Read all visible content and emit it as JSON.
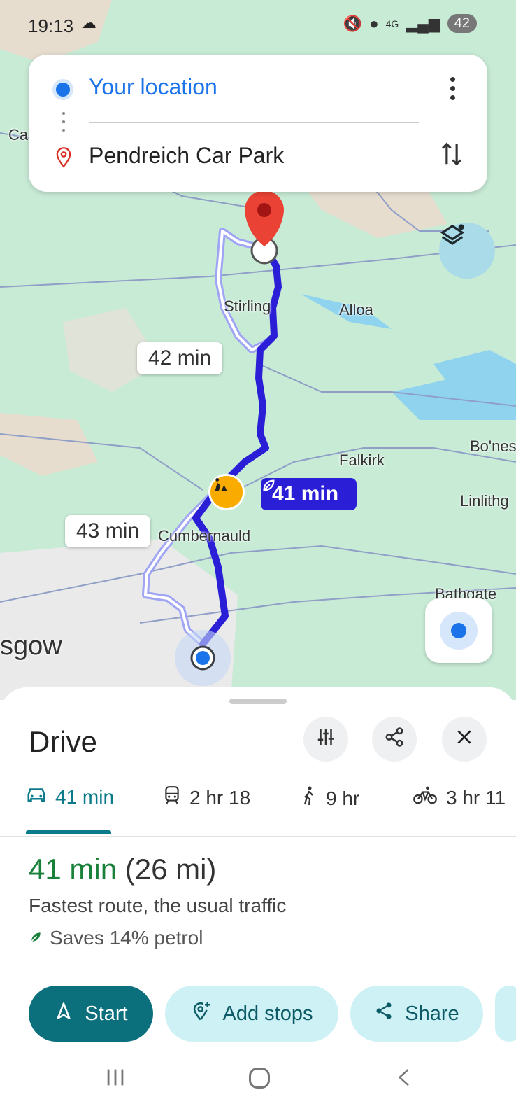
{
  "status_bar": {
    "time": "19:13",
    "battery": "42",
    "network": "4G"
  },
  "search": {
    "origin": "Your location",
    "destination": "Pendreich Car Park"
  },
  "map": {
    "labels": {
      "stirling": "Stirling",
      "alloa": "Alloa",
      "falkirk": "Falkirk",
      "bo_ness": "Bo'nes",
      "linlithgow": "Linlithg",
      "cumbernauld": "Cumbernauld",
      "bathgate": "Bathgate",
      "glasgow": "sgow",
      "ca": "Ca"
    },
    "route_bubbles": {
      "alt1": "42 min",
      "alt2": "43 min",
      "main": "41 min"
    },
    "route_color": "#2a1fd6",
    "alt_route_color": "#9fa4f5"
  },
  "sheet": {
    "title": "Drive",
    "modes": [
      {
        "label": "41 min",
        "icon": "car-icon"
      },
      {
        "label": "2 hr 18",
        "icon": "train-icon"
      },
      {
        "label": "9 hr",
        "icon": "walk-icon"
      },
      {
        "label": "3 hr 11",
        "icon": "bike-icon"
      }
    ],
    "route": {
      "time": "41 min",
      "distance": "(26 mi)",
      "description": "Fastest route, the usual traffic",
      "eco": "Saves 14% petrol"
    },
    "actions": {
      "start": "Start",
      "add_stops": "Add stops",
      "share": "Share"
    }
  }
}
